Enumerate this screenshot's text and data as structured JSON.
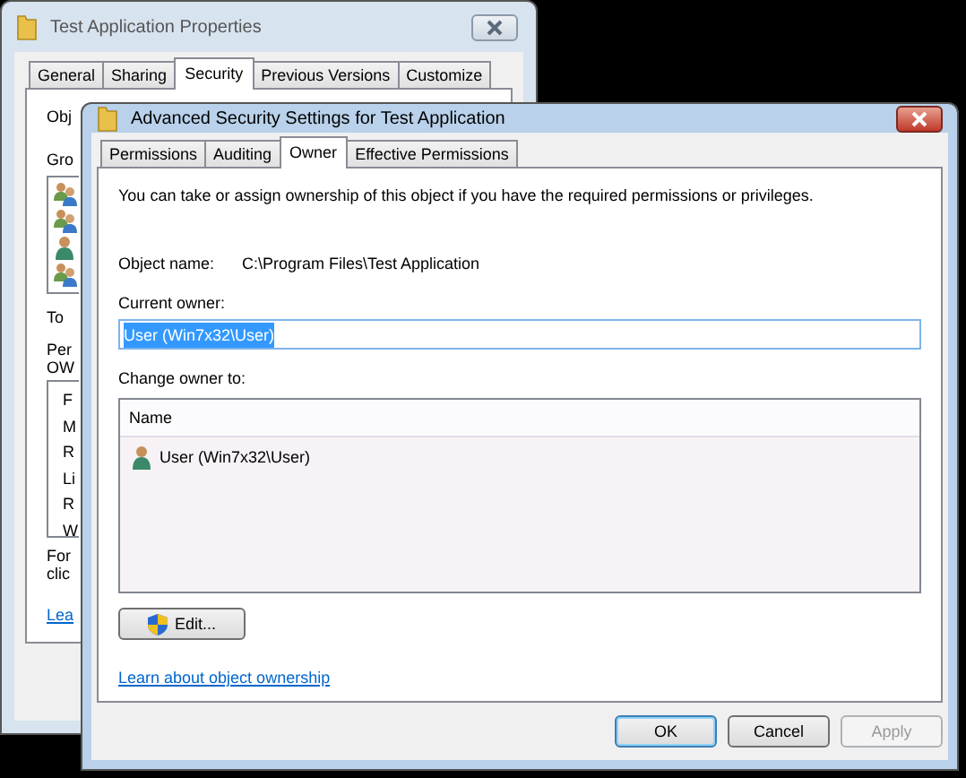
{
  "back_window": {
    "title": "Test Application Properties",
    "active": false,
    "tabs": [
      {
        "label": "General",
        "selected": false
      },
      {
        "label": "Sharing",
        "selected": false
      },
      {
        "label": "Security",
        "selected": true
      },
      {
        "label": "Previous Versions",
        "selected": false
      },
      {
        "label": "Customize",
        "selected": false
      }
    ],
    "object_label": "Obj",
    "groups_label": "Gro",
    "groups": [
      {
        "kind": "group"
      },
      {
        "kind": "group"
      },
      {
        "kind": "user"
      },
      {
        "kind": "group"
      }
    ],
    "change_text": "To",
    "permissions_label": [
      "Per",
      "OW"
    ],
    "permissions": [
      "F",
      "M",
      "R",
      "Li",
      "R",
      "W"
    ],
    "note": [
      "For",
      "clic"
    ],
    "link": "Lea"
  },
  "front_window": {
    "title": "Advanced Security Settings for Test Application",
    "active": true,
    "tabs": [
      {
        "label": "Permissions",
        "selected": false
      },
      {
        "label": "Auditing",
        "selected": false
      },
      {
        "label": "Owner",
        "selected": true
      },
      {
        "label": "Effective Permissions",
        "selected": false
      }
    ],
    "description": "You can take or assign ownership of this object if you have the required permissions or privileges.",
    "object_name": {
      "label": "Object name:",
      "value": "C:\\Program Files\\Test Application"
    },
    "current_owner": {
      "label": "Current owner:",
      "value": "User (Win7x32\\User)",
      "highlighted": true
    },
    "change_owner": {
      "label": "Change owner to:",
      "columns": [
        "Name"
      ],
      "rows": [
        {
          "kind": "user",
          "name": "User (Win7x32\\User)",
          "selected": false
        }
      ]
    },
    "edit_button": "Edit...",
    "link": "Learn about object ownership",
    "buttons": [
      {
        "label": "OK",
        "default": true,
        "disabled": false
      },
      {
        "label": "Cancel",
        "default": false,
        "disabled": false
      },
      {
        "label": "Apply",
        "default": false,
        "disabled": true
      }
    ]
  }
}
